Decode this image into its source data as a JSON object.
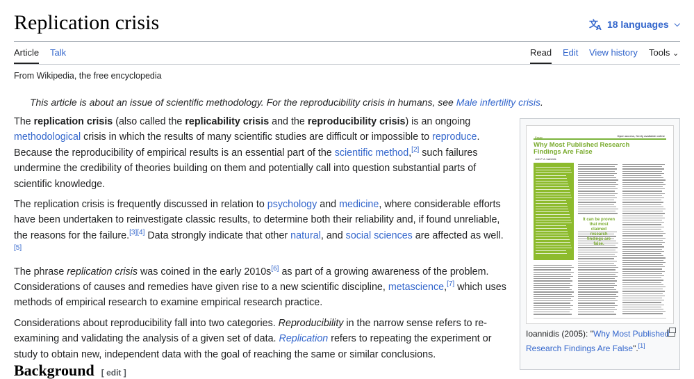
{
  "page": {
    "title": "Replication crisis",
    "languages_label": "18 languages"
  },
  "tabs": {
    "article": "Article",
    "talk": "Talk",
    "read": "Read",
    "edit": "Edit",
    "view_history": "View history",
    "tools": "Tools"
  },
  "tagline": "From Wikipedia, the free encyclopedia",
  "hatnote": {
    "text": "This article is about an issue of scientific methodology. For the reproducibility crisis in humans, see ",
    "link": "Male infertility crisis",
    "end": "."
  },
  "paragraphs": {
    "p1": {
      "t1": "The ",
      "b1": "replication crisis",
      "t2": " (also called the ",
      "b2": "replicability crisis",
      "t3": " and the ",
      "b3": "reproducibility crisis",
      "t4": ") is an ongoing ",
      "l1": "methodological",
      "t5": " crisis in which the results of many scientific studies are difficult or impossible to ",
      "l2": "reproduce",
      "t6": ". Because the reproducibility of empirical results is an essential part of the ",
      "l3": "scientific method",
      "t7": ",",
      "r1": "[2]",
      "t8": " such failures undermine the credibility of theories building on them and potentially call into question substantial parts of scientific knowledge."
    },
    "p2": {
      "t1": "The replication crisis is frequently discussed in relation to ",
      "l1": "psychology",
      "t2": " and ",
      "l2": "medicine",
      "t3": ", where considerable efforts have been undertaken to reinvestigate classic results, to determine both their reliability and, if found unreliable, the reasons for the failure.",
      "r1": "[3]",
      "r2": "[4]",
      "t4": " Data strongly indicate that other ",
      "l3": "natural",
      "t5": ", and ",
      "l4": "social sciences",
      "t6": " are affected as well.",
      "r3": "[5]"
    },
    "p3": {
      "t1": "The phrase ",
      "i1": "replication crisis",
      "t2": " was coined in the early 2010s",
      "r1": "[6]",
      "t3": " as part of a growing awareness of the problem. Considerations of causes and remedies have given rise to a new scientific discipline, ",
      "l1": "metascience",
      "t4": ",",
      "r2": "[7]",
      "t5": " which uses methods of empirical research to examine empirical research practice."
    },
    "p4": {
      "t1": "Considerations about reproducibility fall into two categories. ",
      "i1": "Reproducibility",
      "t2": " in the narrow sense refers to re-examining and validating the analysis of a given set of data. ",
      "l1": "Replication",
      "t3": " refers to repeating the experiment or study to obtain new, independent data with the goal of reaching the same or similar conclusions."
    }
  },
  "infobox": {
    "paper": {
      "kicker": "Essay",
      "top_right": "Open access, freely available online",
      "title": "Why Most Published Research Findings Are False",
      "author": "John P. A. Ioannidis",
      "callout": "It can be proven that most claimed research findings are false."
    },
    "caption": {
      "t1": "Ioannidis (2005): \"",
      "link": "Why Most Published Research Findings Are False",
      "t2": "\".",
      "ref": "[1]"
    }
  },
  "section": {
    "heading": "Background",
    "edit_label": "[ edit ]"
  },
  "colors": {
    "link": "#3366cc",
    "paper_green": "#8dbb2d"
  },
  "icons": [
    "translate-icon",
    "chevron-down-icon",
    "expand-icon"
  ]
}
